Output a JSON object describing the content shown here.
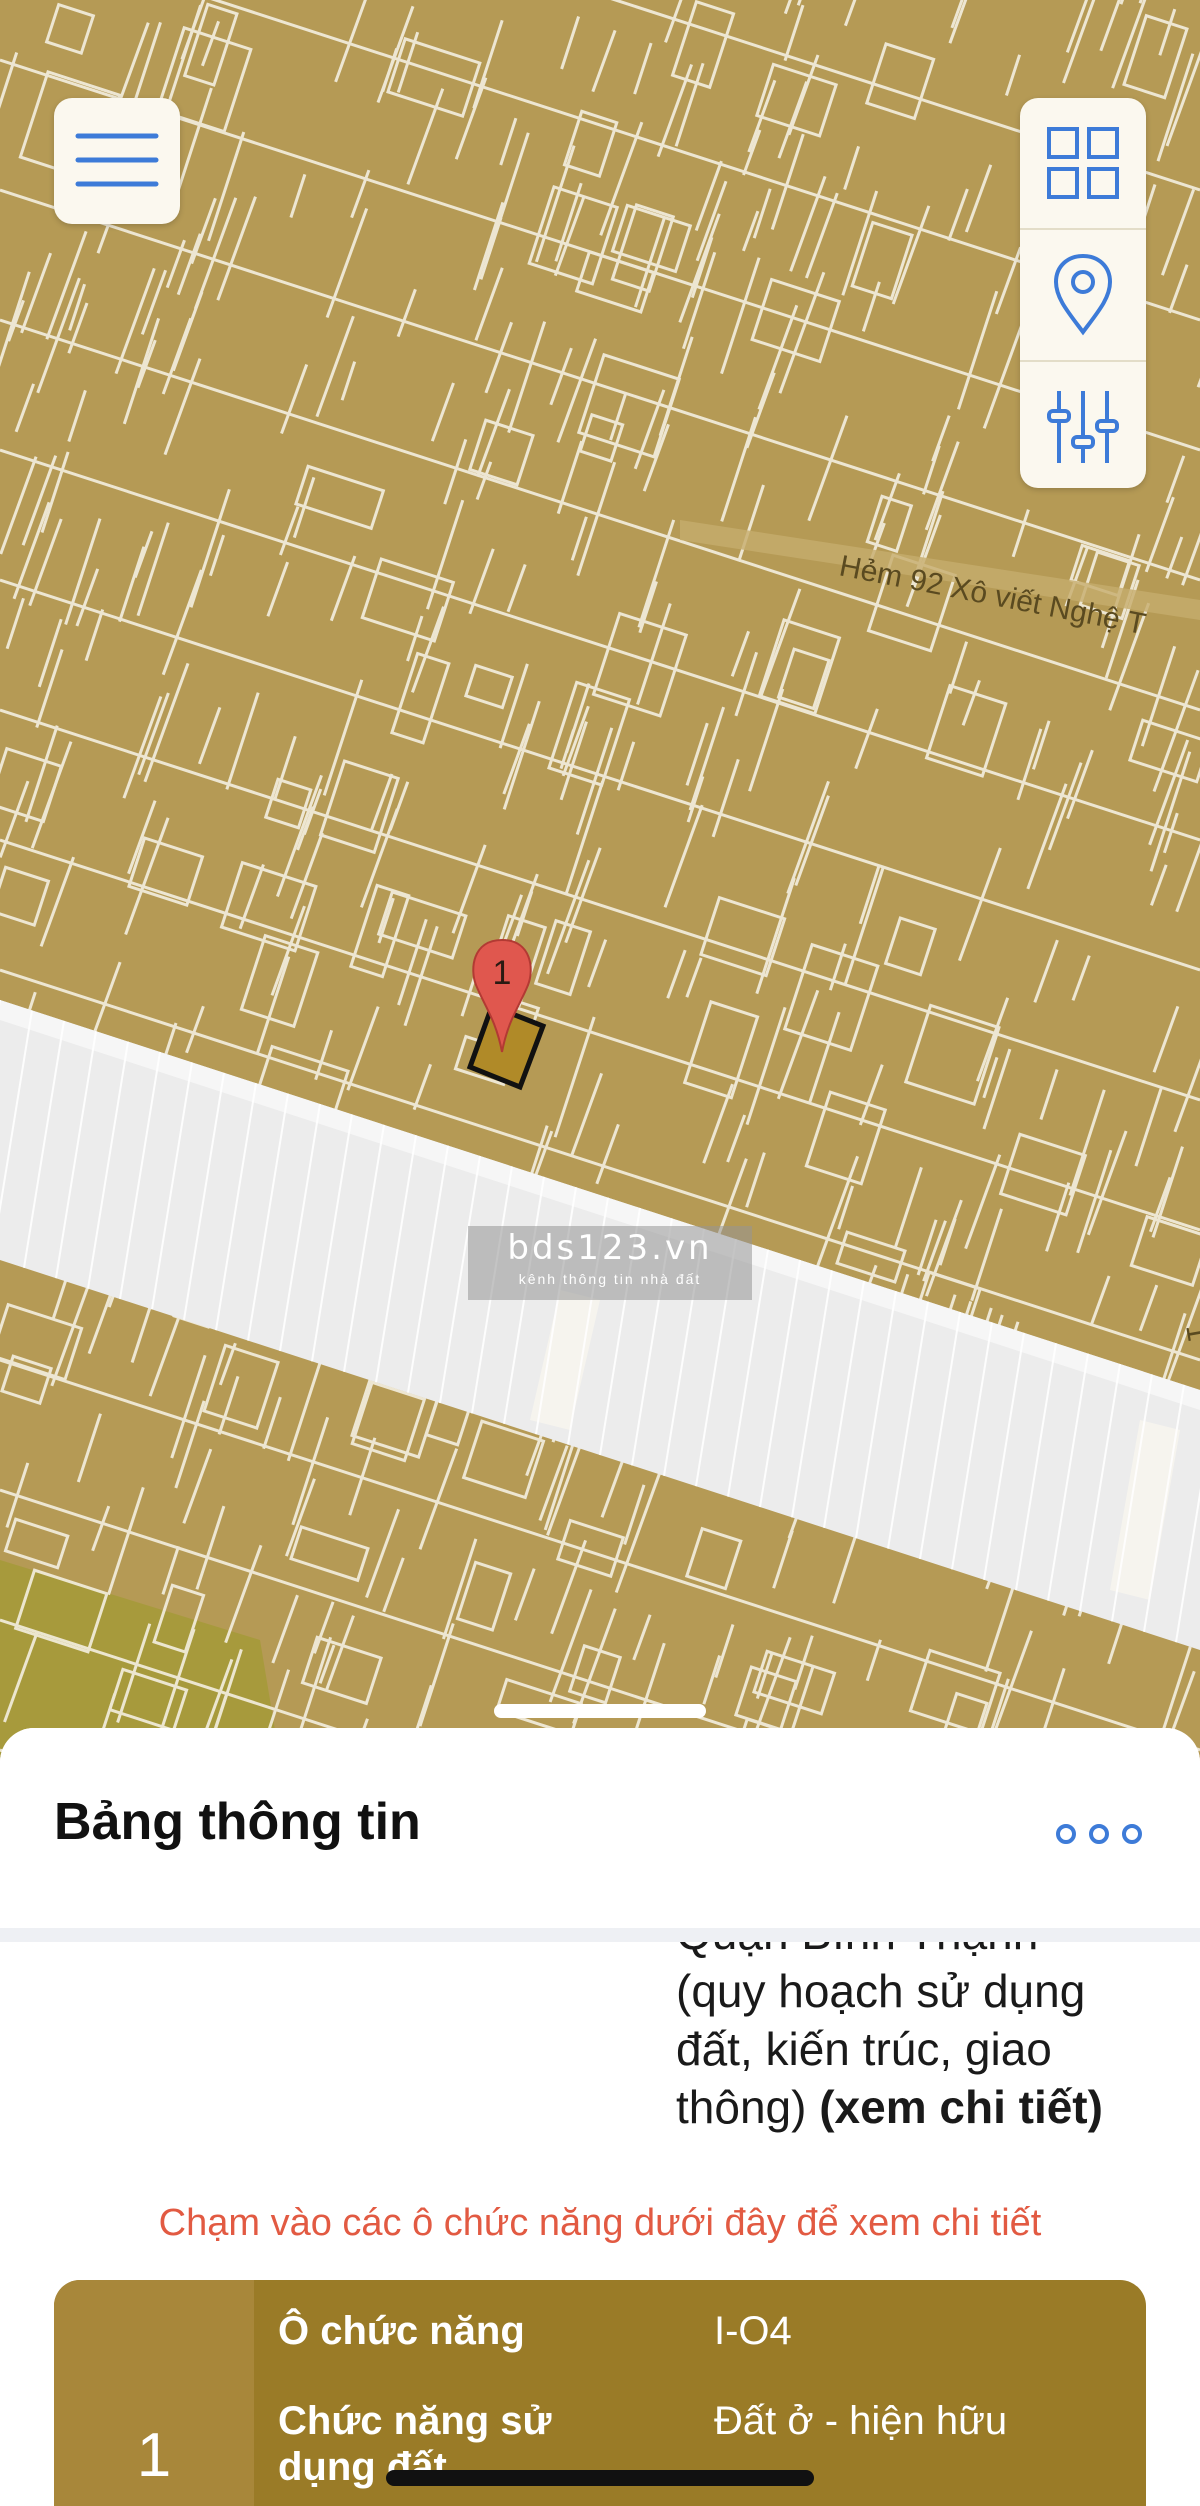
{
  "map": {
    "street_label": "Hẻm 92 Xô viết Nghệ T",
    "marker_number": "1",
    "edge_digit": "1",
    "watermark_title": "bds123.vn",
    "watermark_subtitle": "kênh thông tin nhà đất"
  },
  "toolbar": {
    "menu_icon": "hamburger-icon",
    "layers_icon": "grid-icon",
    "location_icon": "location-pin-icon",
    "filter_icon": "sliders-icon"
  },
  "panel": {
    "title": "Bảng thông tin",
    "more_icon": "more-dots-icon",
    "description_lines": [
      "Quận Bình Thạnh",
      "(quy hoạch sử dụng",
      "đất, kiến trúc, giao",
      "thông)"
    ],
    "details_link": "(xem chi tiết)",
    "hint": "Chạm vào các ô chức năng dưới đây để xem chi tiết",
    "card": {
      "index": "1",
      "rows": [
        {
          "label": "Ô chức năng",
          "value": "I-O4"
        },
        {
          "label": "Chức năng sử dụng đất",
          "value": "Đất ở - hiện hữu"
        }
      ]
    }
  },
  "colors": {
    "parcel_fill": "#b59a55",
    "parcel_line": "#ffffff",
    "road": "#ececec",
    "accent": "#3d7bd8",
    "hint": "#e25a42",
    "card": "#9a7b27"
  }
}
